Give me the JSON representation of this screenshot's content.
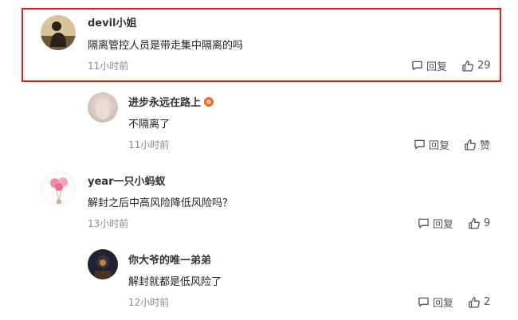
{
  "comments": [
    {
      "username": "devil小姐",
      "text": "隔离管控人员是带走集中隔离的吗",
      "time": "11小时前",
      "reply_label": "回复",
      "like_label": "29",
      "avatar_icon": "person-silhouette-avatar"
    },
    {
      "username": "进步永远在路上",
      "text": "不隔离了",
      "time": "11小时前",
      "reply_label": "回复",
      "like_label": "赞",
      "avatar_icon": "pale-blur-avatar",
      "badge_icon": "medal-badge-icon"
    },
    {
      "username": "year一只小蚂蚁",
      "text": "解封之后中高风险降低风险吗？",
      "time": "13小时前",
      "reply_label": "回复",
      "like_label": "9",
      "avatar_icon": "balloons-avatar"
    },
    {
      "username": "你大爷的唯一弟弟",
      "text": "解封就都是低风险了",
      "time": "12小时前",
      "reply_label": "回复",
      "like_label": "2",
      "avatar_icon": "dark-photo-avatar"
    }
  ],
  "colors": {
    "highlight": "#e0201d",
    "badge": "#f4632b",
    "timestamp": "#8a8a8a"
  }
}
